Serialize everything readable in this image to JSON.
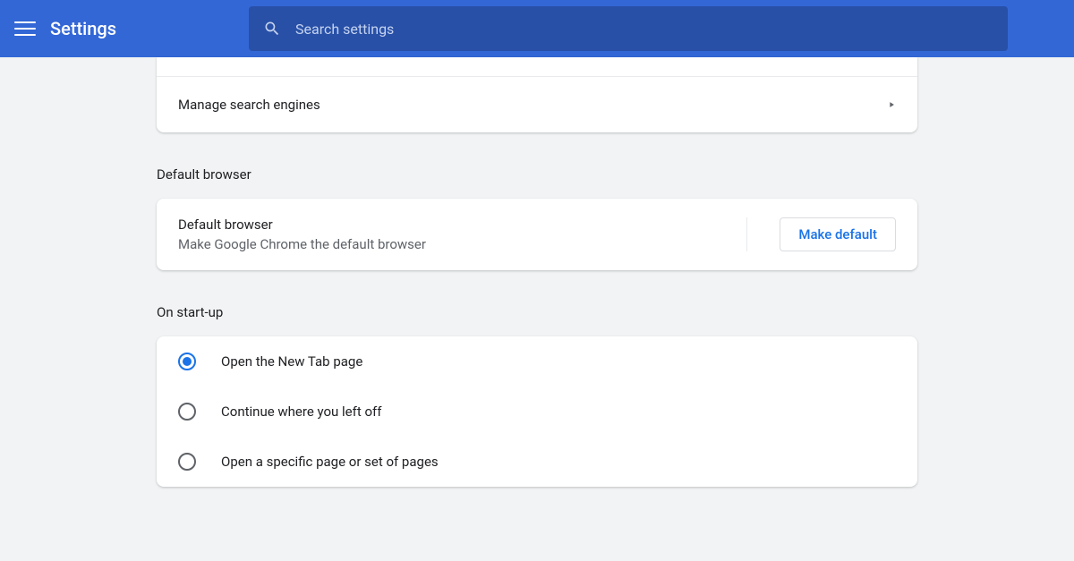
{
  "header": {
    "title": "Settings"
  },
  "search": {
    "placeholder": "Search settings",
    "value": ""
  },
  "search_engine": {
    "manage_label": "Manage search engines"
  },
  "default_browser": {
    "section_title": "Default browser",
    "title": "Default browser",
    "subtitle": "Make Google Chrome the default browser",
    "button_label": "Make default"
  },
  "startup": {
    "section_title": "On start-up",
    "options": [
      {
        "label": "Open the New Tab page",
        "selected": true
      },
      {
        "label": "Continue where you left off",
        "selected": false
      },
      {
        "label": "Open a specific page or set of pages",
        "selected": false
      }
    ]
  }
}
